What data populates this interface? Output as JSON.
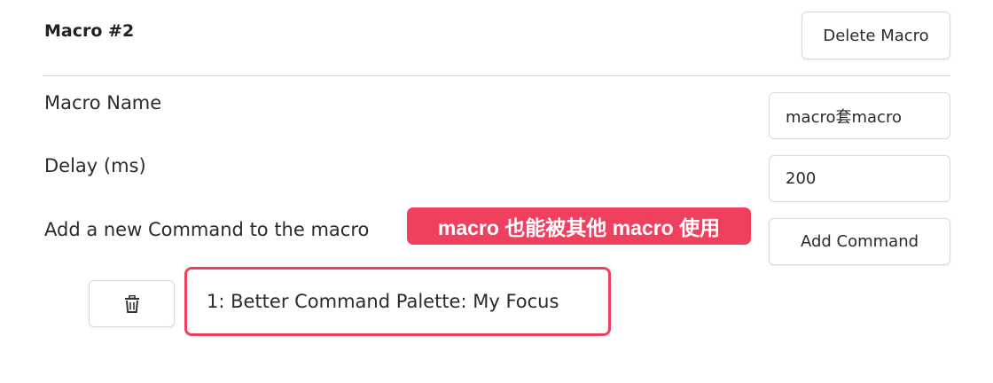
{
  "macro": {
    "title": "Macro #2",
    "delete_label": "Delete Macro"
  },
  "fields": {
    "name_label": "Macro Name",
    "name_value": "macro套macro",
    "delay_label": "Delay (ms)",
    "delay_value": "200",
    "add_label": "Add a new Command to the macro",
    "add_button_label": "Add Command"
  },
  "annotation": {
    "text": "macro 也能被其他 macro 使用",
    "color": "#f0405f"
  },
  "commands": [
    {
      "text": "1: Better Command Palette: My Focus",
      "delete_icon": "trash-icon"
    }
  ]
}
